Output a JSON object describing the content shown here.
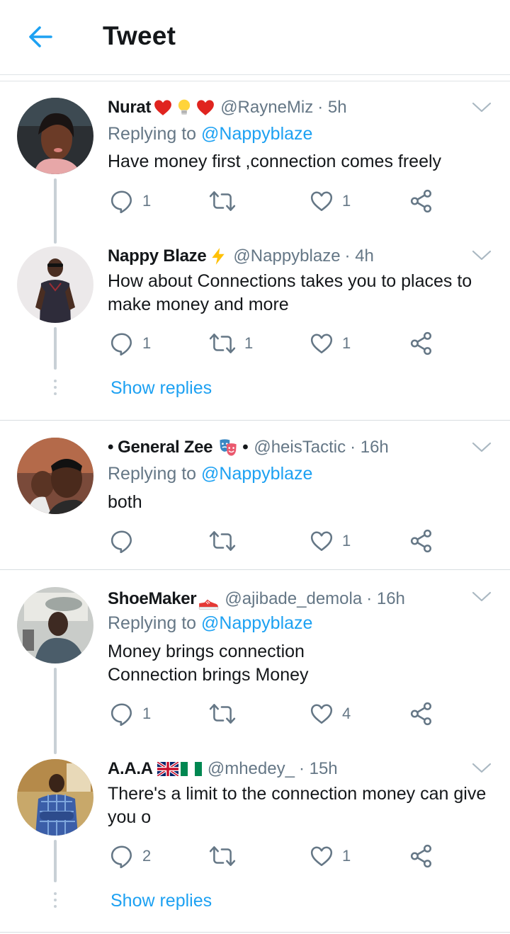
{
  "header": {
    "title": "Tweet",
    "back_icon": "arrow-left-icon",
    "accent": "#1da1f2"
  },
  "tweets": [
    {
      "name": "Nurat",
      "emojis": [
        "red-heart-icon",
        "light-bulb-icon",
        "red-heart-icon"
      ],
      "handle": "@RayneMiz",
      "time": "· 5h",
      "replying_prefix": "Replying to",
      "replying_mention": "@Nappyblaze",
      "text": "Have money first ,connection comes freely",
      "replies": "1",
      "retweets": "",
      "likes": "1"
    },
    {
      "name": "Nappy Blaze",
      "emojis": [
        "lightning-icon"
      ],
      "handle": "@Nappyblaze",
      "time": "· 4h",
      "text_lines": [
        "How about Connections takes you to places to",
        "make money and more"
      ],
      "replies": "1",
      "retweets": "1",
      "likes": "1",
      "show_replies": "Show replies"
    },
    {
      "name_prefix": "•",
      "name": "General Zee",
      "emojis": [
        "theater-masks-icon"
      ],
      "name_suffix": "•",
      "handle": "@heisTactic",
      "time": "· 16h",
      "replying_prefix": "Replying to",
      "replying_mention": "@Nappyblaze",
      "text": "both",
      "replies": "",
      "retweets": "",
      "likes": "1"
    },
    {
      "name": "ShoeMaker",
      "emojis": [
        "shoe-icon"
      ],
      "handle": "@ajibade_demola",
      "time": "· 16h",
      "replying_prefix": "Replying to",
      "replying_mention": "@Nappyblaze",
      "text_lines": [
        "Money brings connection",
        "Connection brings Money"
      ],
      "replies": "1",
      "retweets": "",
      "likes": "4"
    },
    {
      "name": "A.A.A",
      "emojis": [
        "uk-flag-icon",
        "nigeria-flag-icon"
      ],
      "handle": "@mhedey_",
      "time": "· 15h",
      "text_lines": [
        "There's a limit to the connection money can give",
        "you o"
      ],
      "replies": "2",
      "retweets": "",
      "likes": "1",
      "show_replies": "Show replies"
    }
  ]
}
